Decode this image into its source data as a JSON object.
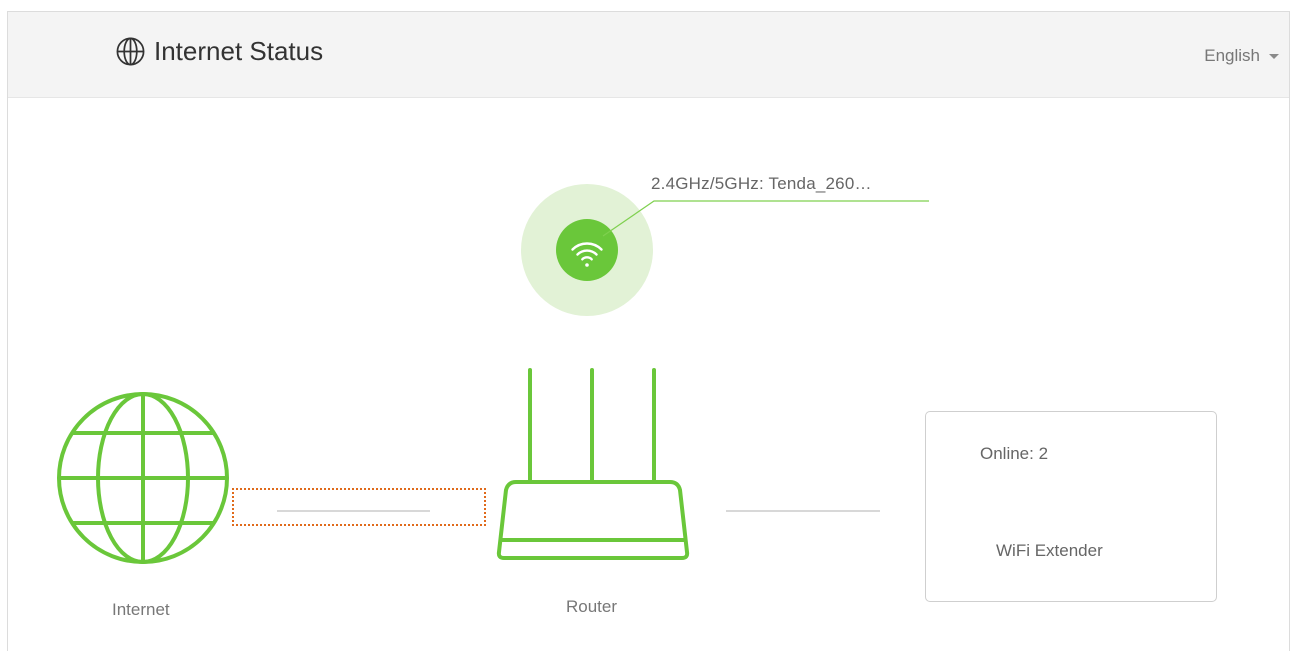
{
  "header": {
    "title": "Internet Status",
    "language": "English"
  },
  "wireless": {
    "ssid_label": "2.4GHz/5GHz: Tenda_260…"
  },
  "nodes": {
    "internet_label": "Internet",
    "router_label": "Router"
  },
  "clients": {
    "online_label": "Online:  2",
    "extender_label": "WiFi Extender"
  },
  "colors": {
    "accent_green": "#6ac73a",
    "wifi_halo": "#e2f2d6",
    "highlight_orange": "#e06a1b"
  },
  "icons": {
    "title": "globe-outline-icon",
    "language": "caret-down-icon",
    "wifi": "wifi-icon",
    "internet": "globe-icon",
    "router": "router-icon",
    "devices": "devices-icon",
    "extender": "wifi-extender-icon"
  }
}
